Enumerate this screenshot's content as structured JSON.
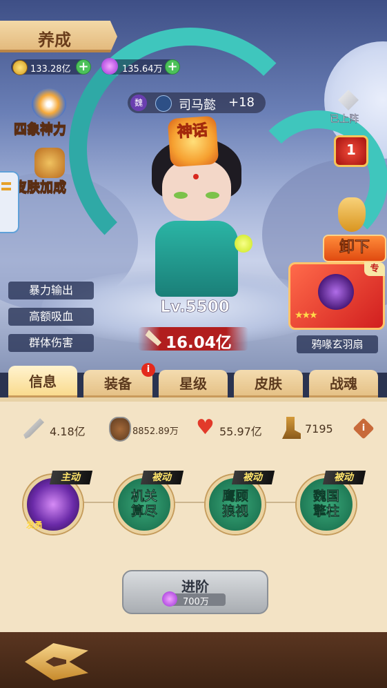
{
  "header": {
    "title": "养成"
  },
  "resources": {
    "gold": {
      "value": "133.28亿",
      "icon": "coin-icon"
    },
    "gem": {
      "value": "135.64万",
      "icon": "purple-gem-icon"
    }
  },
  "side_buttons": {
    "four_gods": "四象神力",
    "skin": "皮肤加成"
  },
  "tags": [
    "暴力输出",
    "高额吸血",
    "群体伤害"
  ],
  "hero": {
    "faction": "魏",
    "name": "司马懿",
    "plus": "+18",
    "rarity": "神话",
    "level": "Lv.5500",
    "power": "16.04亿"
  },
  "right_panel": {
    "deployed": "已上阵",
    "slot_number": "1",
    "unequip": "卸下",
    "exclusive_tag": "专",
    "weapon_name": "鸦喙玄羽扇",
    "weapon_stars": 3
  },
  "tabs": [
    {
      "label": "信息",
      "active": true
    },
    {
      "label": "装备",
      "badge": "i"
    },
    {
      "label": "星级"
    },
    {
      "label": "皮肤"
    },
    {
      "label": "战魂"
    }
  ],
  "stats": {
    "attack": "4.18亿",
    "defense": "8852.89万",
    "hp": "55.97亿",
    "speed": "7195",
    "info_badge": "i"
  },
  "skills": [
    {
      "type": "主动",
      "name": "",
      "small": "发勇"
    },
    {
      "type": "被动",
      "line1": "机关",
      "line2": "算尽"
    },
    {
      "type": "被动",
      "line1": "鹰顾",
      "line2": "狼视"
    },
    {
      "type": "被动",
      "line1": "魏国",
      "line2": "擎柱"
    }
  ],
  "advance": {
    "label": "进阶",
    "cost": "700万"
  },
  "colors": {
    "accent_gold": "#f2c063",
    "skill_green": "#2a8f63",
    "power_red": "#b11e1e",
    "panel_bg": "#f3e3c5"
  }
}
